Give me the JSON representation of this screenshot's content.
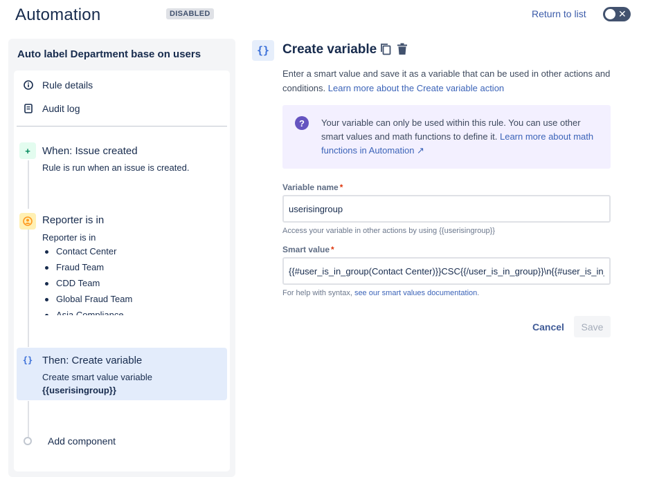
{
  "header": {
    "title": "Automation",
    "status_badge": "DISABLED",
    "return_link": "Return to list",
    "toggle_symbol": "✕"
  },
  "rule": {
    "name": "Auto label Department base on users",
    "nav": [
      {
        "label": "Rule details",
        "icon": "info-icon"
      },
      {
        "label": "Audit log",
        "icon": "document-icon"
      }
    ],
    "components": [
      {
        "icon_glyph": "+",
        "icon": "plus-icon",
        "title": "When: Issue created",
        "description": "Rule is run when an issue is created.",
        "icon_color": "#00875a",
        "icon_bg": "#e3fcef"
      },
      {
        "icon": "user-condition-icon",
        "title": "Reporter is in",
        "description": "Reporter is in",
        "items": [
          "Contact Center",
          "Fraud Team",
          "CDD Team",
          "Global Fraud Team",
          "Asia Compliance"
        ],
        "icon_color": "#ff991f",
        "icon_bg": "#fff0b3"
      },
      {
        "icon_glyph": "{}",
        "icon": "braces-icon",
        "title": "Then: Create variable",
        "description": "Create smart value variable",
        "variable": "{{userisingroup}}",
        "selected": true,
        "icon_color": "#3a6fd8"
      }
    ],
    "add_component": "Add component"
  },
  "detail": {
    "icon_glyph": "{}",
    "title": "Create variable",
    "description": "Enter a smart value and save it as a variable that can be used in other actions and conditions.",
    "description_link": "Learn more about the Create variable action",
    "info_icon_glyph": "?",
    "info_text": "Your variable can only be used within this rule. You can use other smart values and math functions to define it.",
    "info_link": "Learn more about math functions in Automation ↗",
    "variable_name": {
      "label": "Variable name",
      "required_mark": "*",
      "value": "userisingroup",
      "helper": "Access your variable in other actions by using {{userisingroup}}"
    },
    "smart_value": {
      "label": "Smart value",
      "required_mark": "*",
      "value": "{{#user_is_in_group(Contact Center)}}CSC{{/user_is_in_group}}\\n{{#user_is_in_group(Fraud Team)}}",
      "helper_prefix": "For help with syntax,",
      "helper_link": "see our smart values documentation",
      "helper_suffix": "."
    },
    "cancel_label": "Cancel",
    "save_label": "Save"
  }
}
